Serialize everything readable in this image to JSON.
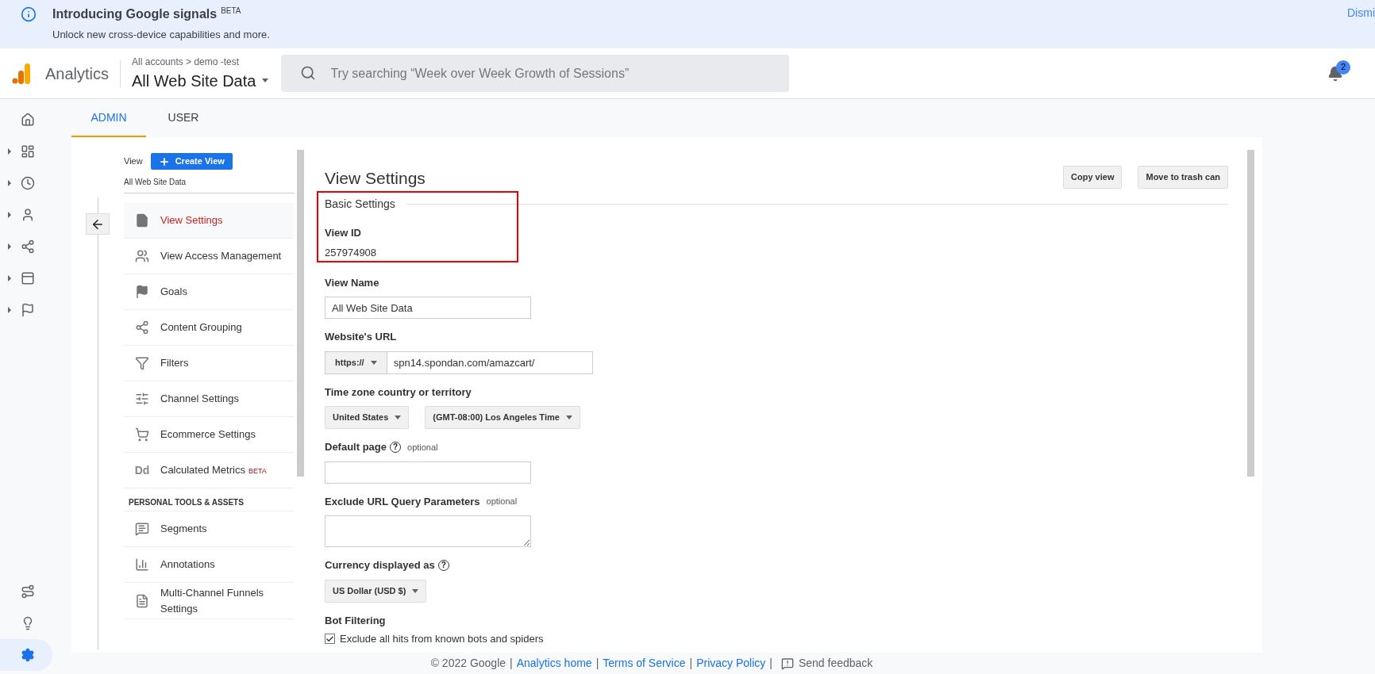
{
  "banner": {
    "title": "Introducing Google signals",
    "badge": "BETA",
    "subtitle": "Unlock new cross-device capabilities and more.",
    "dismiss": "Dismi"
  },
  "header": {
    "product": "Analytics",
    "breadcrumb": "All accounts > demo -test",
    "property": "All Web Site Data",
    "search_placeholder": "Try searching “Week over Week Growth of Sessions”",
    "notifications": "2"
  },
  "rail": [
    {
      "expandable": false,
      "selected": false
    },
    {
      "expandable": true,
      "selected": false
    },
    {
      "expandable": true,
      "selected": false
    },
    {
      "expandable": true,
      "selected": false
    },
    {
      "expandable": true,
      "selected": false
    },
    {
      "expandable": true,
      "selected": false
    },
    {
      "expandable": true,
      "selected": false
    }
  ],
  "rail_bottom": [
    {
      "selected": false
    },
    {
      "selected": false
    },
    {
      "selected": true
    }
  ],
  "tabs": [
    {
      "label": "ADMIN",
      "selected": true
    },
    {
      "label": "USER",
      "selected": false
    }
  ],
  "view": {
    "label": "View",
    "create": "Create View",
    "name": "All Web Site Data"
  },
  "nav": [
    {
      "kind": "item",
      "label": "View Settings",
      "selected": true
    },
    {
      "kind": "item",
      "label": "View Access Management",
      "selected": false
    },
    {
      "kind": "item",
      "label": "Goals",
      "selected": false
    },
    {
      "kind": "item",
      "label": "Content Grouping",
      "selected": false
    },
    {
      "kind": "item",
      "label": "Filters",
      "selected": false
    },
    {
      "kind": "item",
      "label": "Channel Settings",
      "selected": false
    },
    {
      "kind": "item",
      "label": "Ecommerce Settings",
      "selected": false
    },
    {
      "kind": "item",
      "label": "Calculated Metrics",
      "badge": "BETA",
      "icon_text": "Dd",
      "selected": false
    },
    {
      "kind": "heading",
      "label": "PERSONAL TOOLS & ASSETS"
    },
    {
      "kind": "item",
      "label": "Segments",
      "selected": false
    },
    {
      "kind": "item",
      "label": "Annotations",
      "selected": false
    },
    {
      "kind": "item",
      "label": "Multi-Channel Funnels Settings",
      "selected": false
    }
  ],
  "content": {
    "title": "View Settings",
    "buttons": [
      "Copy view",
      "Move to trash can"
    ],
    "section": "Basic Settings",
    "highlighted": true,
    "view_id": {
      "label": "View ID",
      "value": "257974908"
    },
    "fields": [
      {
        "kind": "text",
        "label": "View Name",
        "value": "All Web Site Data"
      },
      {
        "kind": "url",
        "label": "Website's URL",
        "protocol": "https://",
        "value": "spn14.spondan.com/amazcart/"
      },
      {
        "kind": "selects",
        "label": "Time zone country or territory",
        "options": [
          "United States",
          "(GMT-08:00) Los Angeles Time"
        ]
      },
      {
        "kind": "text",
        "label": "Default page",
        "help": "?",
        "optional": "optional"
      },
      {
        "kind": "textarea",
        "label": "Exclude URL Query Parameters",
        "optional": "optional"
      },
      {
        "kind": "select",
        "label": "Currency displayed as",
        "help": "?",
        "options": [
          "US Dollar (USD $)"
        ]
      },
      {
        "kind": "checkbox",
        "label": "Bot Filtering",
        "text": "Exclude all hits from known bots and spiders",
        "checked": true
      }
    ]
  },
  "footer": [
    {
      "kind": "text",
      "text": "© 2022 Google"
    },
    {
      "kind": "sep",
      "text": "|"
    },
    {
      "kind": "link",
      "text": "Analytics home"
    },
    {
      "kind": "sep",
      "text": "|"
    },
    {
      "kind": "link",
      "text": "Terms of Service"
    },
    {
      "kind": "sep",
      "text": "|"
    },
    {
      "kind": "link",
      "text": "Privacy Policy"
    },
    {
      "kind": "sep",
      "text": "|"
    },
    {
      "kind": "feedback",
      "text": "Send feedback"
    }
  ]
}
